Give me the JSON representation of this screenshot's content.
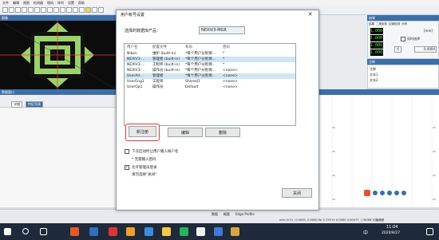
{
  "menu": [
    "文件",
    "编辑",
    "视图",
    "检测器",
    "相机",
    "阵列",
    "设置",
    "帮助"
  ],
  "viewer_title": "图像",
  "center_header": "注释",
  "right_panel": {
    "title": "结果",
    "tabs": [
      "结果",
      "二维坐标",
      "边缘检测",
      "分析"
    ],
    "unit": "[mm]",
    "values": [
      "1.000",
      "1.000",
      "1.000",
      "1.000"
    ],
    "checkbox_label": "同时选择",
    "x_label": "X",
    "x_value": "0.0000",
    "list_title": "注释",
    "list_items": [
      "注释",
      "文本1",
      "文本2"
    ]
  },
  "lower_header": "数据窗口",
  "lower_tabs": [
    "详细",
    "特征列表"
  ],
  "dialog": {
    "title": "用户帐号设置",
    "db_label": "选择的数据库产品：",
    "db_value": "NEXIV3-MGR",
    "columns": [
      "用户名",
      "配置文件",
      "布局",
      "密码"
    ],
    "rows": [
      [
        "Nikon",
        "维护 (built-in)",
        "*每个用户分别保...",
        "*"
      ],
      [
        "NEXIV3-...",
        "管理者 (built-in)",
        "*每个用户分别保...",
        "*"
      ],
      [
        "NEXIV3-...",
        "工程师 (built-in)",
        "*每个用户分别保...",
        "*"
      ],
      [
        "NEXIV3-...",
        "操作员 (built-in)",
        "*每个用户分别保...",
        "<none>"
      ],
      [
        "UserAd...",
        "管理者",
        "*每个用户分别保...",
        "<none>"
      ],
      [
        "UserEng1",
        "工程师",
        "Shared1",
        "<none>"
      ],
      [
        "UserOp1",
        "操作员",
        "Default",
        "<none>"
      ]
    ],
    "btn_new": "新注册",
    "btn_edit": "编辑",
    "btn_delete": "删除",
    "opt1": "下次启动时让用户输入帐户名",
    "note": "* 无需输入密码",
    "opt2": "允许管理员登录",
    "opt2_sub": "请勿选择\"关闭\"",
    "opt2_checked": true,
    "btn_apply": "关闭"
  },
  "status": {
    "left_tabs": [
      "数据",
      "概要",
      "Edge Profile"
    ],
    "coords": "mm (X,Y) : 0.0000, 0.0000 W: 0.729 H: 0.0000 0.0007T : | NONE 均值偏差"
  },
  "taskbar": {
    "time": "11:04",
    "date": "2020/8/27",
    "ime": "中"
  }
}
